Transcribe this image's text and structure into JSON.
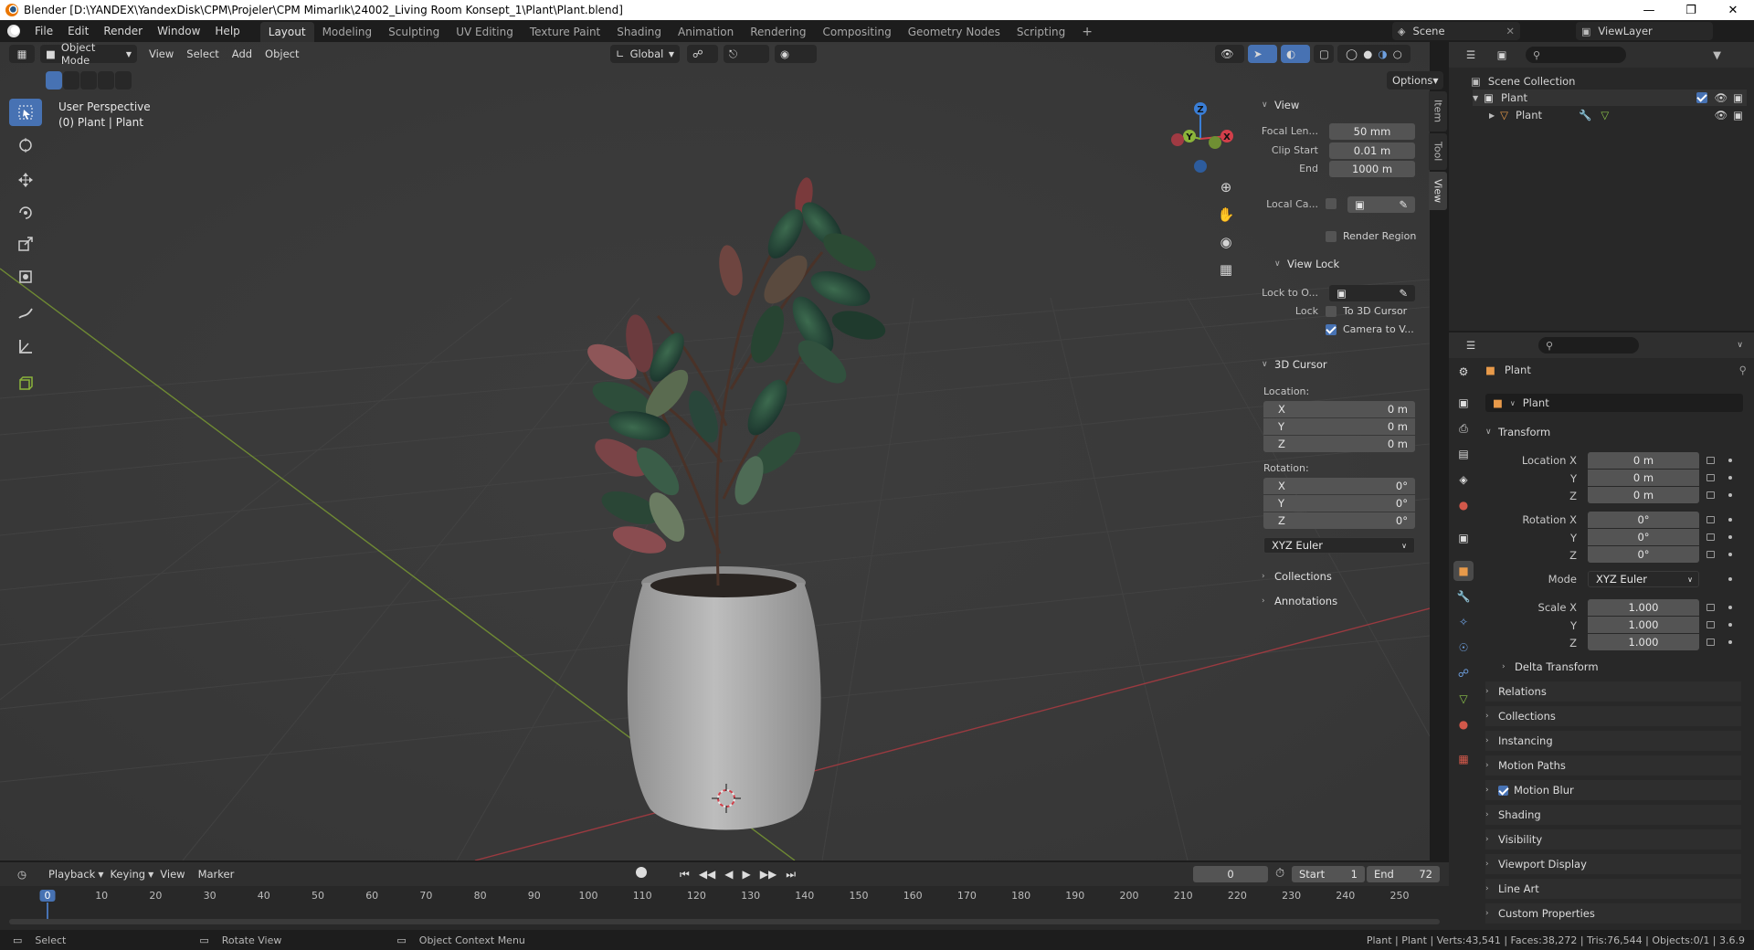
{
  "titlebar": {
    "title": "Blender [D:\\YANDEX\\YandexDisk\\CPM\\Projeler\\CPM Mimarlık\\24002_Living Room Konsept_1\\Plant\\Plant.blend]"
  },
  "menu": [
    "File",
    "Edit",
    "Render",
    "Window",
    "Help"
  ],
  "workspaces": [
    "Layout",
    "Modeling",
    "Sculpting",
    "UV Editing",
    "Texture Paint",
    "Shading",
    "Animation",
    "Rendering",
    "Compositing",
    "Geometry Nodes",
    "Scripting"
  ],
  "scene": {
    "name": "Scene",
    "view_layer": "ViewLayer"
  },
  "vp_header": {
    "mode": "Object Mode",
    "view": "View",
    "select": "Select",
    "add": "Add",
    "object": "Object",
    "orientation": "Global",
    "options": "Options"
  },
  "viewport": {
    "perspective": "User Perspective",
    "object_info": "(0) Plant | Plant"
  },
  "gizmo": {
    "x": "X",
    "y": "Y",
    "z": "Z"
  },
  "side_tabs": [
    "Item",
    "Tool",
    "View"
  ],
  "npanel": {
    "view_title": "View",
    "focal_label": "Focal Len...",
    "focal_value": "50 mm",
    "clip_start_label": "Clip Start",
    "clip_start_value": "0.01 m",
    "end_label": "End",
    "end_value": "1000 m",
    "local_cam_label": "Local Ca...",
    "render_region": "Render Region",
    "view_lock_title": "View Lock",
    "lock_to_label": "Lock to O...",
    "lock_label": "Lock",
    "to_3d_cursor": "To 3D Cursor",
    "camera_to_view": "Camera to V...",
    "cursor_title": "3D Cursor",
    "location_label": "Location:",
    "rotation_label": "Rotation:",
    "loc": [
      {
        "axis": "X",
        "value": "0 m"
      },
      {
        "axis": "Y",
        "value": "0 m"
      },
      {
        "axis": "Z",
        "value": "0 m"
      }
    ],
    "rot": [
      {
        "axis": "X",
        "value": "0°"
      },
      {
        "axis": "Y",
        "value": "0°"
      },
      {
        "axis": "Z",
        "value": "0°"
      }
    ],
    "rotation_mode": "XYZ Euler",
    "collections": "Collections",
    "annotations": "Annotations"
  },
  "outliner": {
    "scene_collection": "Scene Collection",
    "collection": "Plant",
    "object": "Plant"
  },
  "properties": {
    "object_name": "Plant",
    "data_name": "Plant",
    "transform": "Transform",
    "location_x_label": "Location X",
    "y_label": "Y",
    "z_label": "Z",
    "location": [
      "0 m",
      "0 m",
      "0 m"
    ],
    "rotation_x_label": "Rotation X",
    "rotation": [
      "0°",
      "0°",
      "0°"
    ],
    "mode_label": "Mode",
    "mode_value": "XYZ Euler",
    "scale_x_label": "Scale X",
    "scale": [
      "1.000",
      "1.000",
      "1.000"
    ],
    "delta_transform": "Delta Transform",
    "sections": [
      "Relations",
      "Collections",
      "Instancing",
      "Motion Paths",
      "Motion Blur",
      "Shading",
      "Visibility",
      "Viewport Display",
      "Line Art",
      "Custom Properties"
    ]
  },
  "timeline": {
    "playback": "Playback",
    "keying": "Keying",
    "view": "View",
    "marker": "Marker",
    "current_frame": "0",
    "start_label": "Start",
    "start": "1",
    "end_label": "End",
    "end": "72",
    "ticks": [
      "0",
      "10",
      "20",
      "30",
      "40",
      "50",
      "60",
      "70",
      "80",
      "90",
      "100",
      "110",
      "120",
      "130",
      "140",
      "150",
      "160",
      "170",
      "180",
      "190",
      "200",
      "210",
      "220",
      "230",
      "240",
      "250"
    ],
    "playhead": "0"
  },
  "statusbar": {
    "select": "Select",
    "rotate": "Rotate View",
    "context": "Object Context Menu",
    "stats": "Plant | Plant | Verts:43,541 | Faces:38,272 | Tris:76,544 | Objects:0/1 | 3.6.9"
  },
  "colors": {
    "accent": "#4772b3",
    "x_axis": "#d23f4a",
    "y_axis": "#8bb43a",
    "z_axis": "#3a7ed6"
  }
}
